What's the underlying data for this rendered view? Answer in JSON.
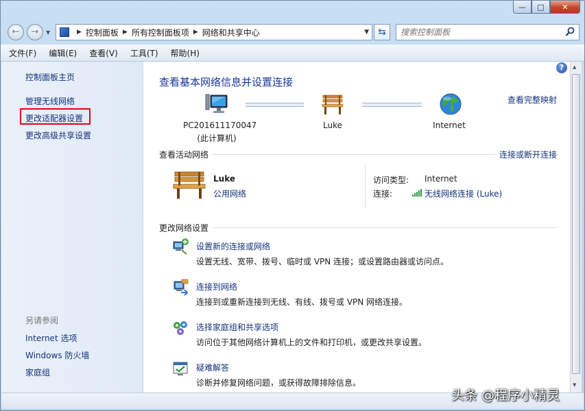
{
  "window": {
    "caption_buttons": {
      "minimize": "—",
      "maximize": "□",
      "close": "✕"
    }
  },
  "navigation": {
    "back_glyph": "←",
    "forward_glyph": "→",
    "breadcrumb": [
      "控制面板",
      "所有控制面板项",
      "网络和共享中心"
    ],
    "search_placeholder": "搜索控制面板"
  },
  "menu": [
    "文件(F)",
    "编辑(E)",
    "查看(V)",
    "工具(T)",
    "帮助(H)"
  ],
  "sidebar": {
    "links": [
      "控制面板主页",
      "管理无线网络",
      "更改适配器设置",
      "更改高级共享设置"
    ],
    "see_also_title": "另请参阅",
    "see_also": [
      "Internet 选项",
      "Windows 防火墙",
      "家庭组"
    ]
  },
  "main": {
    "title": "查看基本网络信息并设置连接",
    "full_map_link": "查看完整映射",
    "map": {
      "computer_name": "PC201611170047",
      "computer_sub": "(此计算机)",
      "network_name": "Luke",
      "internet_name": "Internet"
    },
    "active_section": {
      "title": "查看活动网络",
      "action_link": "连接或断开连接",
      "network_name": "Luke",
      "network_type": "公用网络",
      "access_type_label": "访问类型:",
      "access_type_value": "Internet",
      "connection_label": "连接:",
      "connection_value": "无线网络连接 (Luke)"
    },
    "change_section": {
      "title": "更改网络设置",
      "tasks": [
        {
          "title": "设置新的连接或网络",
          "desc": "设置无线、宽带、拨号、临时或 VPN 连接；或设置路由器或访问点。"
        },
        {
          "title": "连接到网络",
          "desc": "连接到或重新连接到无线、有线、拨号或 VPN 网络连接。"
        },
        {
          "title": "选择家庭组和共享选项",
          "desc": "访问位于其他网络计算机上的文件和打印机，或更改共享设置。"
        },
        {
          "title": "疑难解答",
          "desc": "诊断并修复网络问题，或获得故障排除信息。"
        }
      ]
    }
  },
  "watermark": "头条 @程序小精灵",
  "colors": {
    "link": "#15327a",
    "title": "#17359a",
    "highlight_box": "#e4001b"
  }
}
